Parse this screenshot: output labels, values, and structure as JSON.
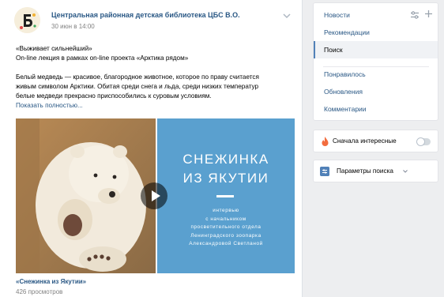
{
  "post": {
    "author": "Центральная районная детская библиотека ЦБС В.О.",
    "date": "30 июн в 14:00",
    "text_lines": [
      "«Выживает сильнейший»",
      "On-line лекция в рамках on-line проекта «Арктика рядом»",
      "",
      "Белый медведь — красивое, благородное животное, которое по праву считается",
      "живым символом Арктики. Обитая среди снега и льда, среди низких температур",
      "белые медведи прекрасно приспособились к суровым условиям."
    ],
    "show_more": "Показать полностью...",
    "video": {
      "title_line1": "СНЕЖИНКА",
      "title_line2": "ИЗ ЯКУТИИ",
      "subtitle_lines": [
        "интервью",
        "с начальником",
        "просветительного отдела",
        "Ленинградского зоопарка",
        "Александровой Светланой"
      ],
      "name": "«Снежинка из Якутии»",
      "views": "426 просмотров"
    }
  },
  "sidebar": {
    "menu": [
      {
        "label": "Новости",
        "active": false
      },
      {
        "label": "Рекомендации",
        "active": false
      },
      {
        "label": "Поиск",
        "active": true
      },
      {
        "label": "Понравилось",
        "active": false
      },
      {
        "label": "Обновления",
        "active": false
      },
      {
        "label": "Комментарии",
        "active": false
      }
    ],
    "interesting_first": "Сначала интересные",
    "interesting_first_enabled": false,
    "search_params": "Параметры поиска"
  },
  "colors": {
    "link": "#2a5885",
    "accent": "#5181b8",
    "video_background": "#5aa0cf",
    "page_background": "#edeef0"
  },
  "icons": [
    "library-logo",
    "chevron-down-icon",
    "tune-icon",
    "plus-icon",
    "fire-icon",
    "filter-icon",
    "play-icon"
  ]
}
